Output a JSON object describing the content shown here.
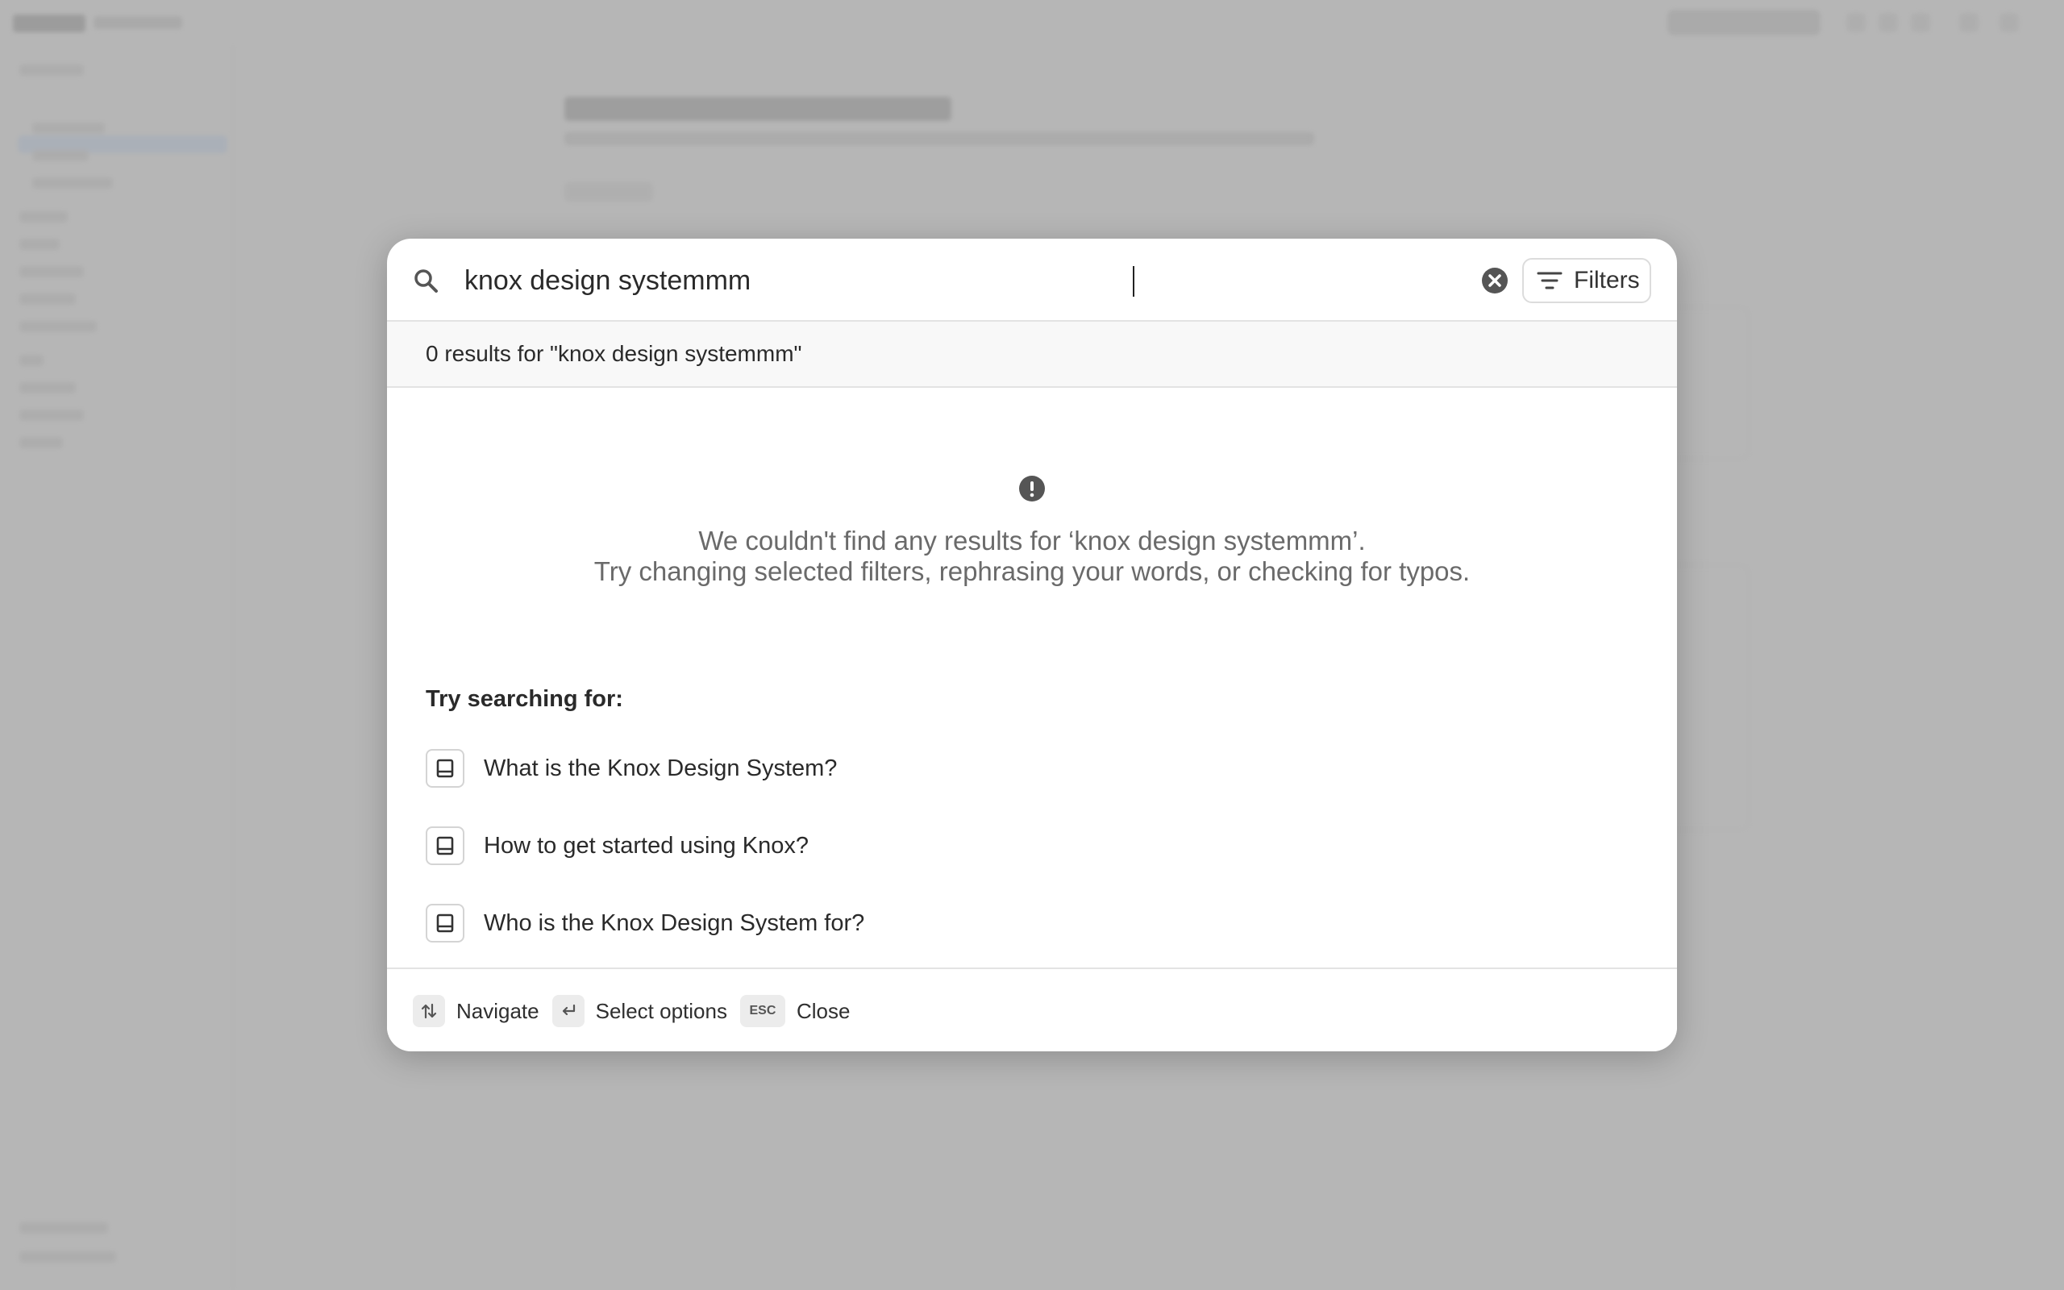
{
  "search": {
    "value": "knox design systemmm",
    "filters_label": "Filters"
  },
  "results": {
    "summary": "0 results for \"knox design systemmm\""
  },
  "empty_state": {
    "line1": "We couldn't find any results for ‘knox design systemmm’.",
    "line2": "Try changing selected filters, rephrasing your words, or checking for typos."
  },
  "suggestions": {
    "heading": "Try searching for:",
    "items": [
      {
        "label": "What is the Knox Design System?",
        "icon": "book-icon"
      },
      {
        "label": "How to get started using Knox?",
        "icon": "book-icon"
      },
      {
        "label": "Who is the Knox Design System for?",
        "icon": "book-icon"
      }
    ]
  },
  "footer": {
    "navigate_label": "Navigate",
    "select_label": "Select options",
    "esc_key": "ESC",
    "close_label": "Close"
  },
  "colors": {
    "backdrop": "#c4c4c4",
    "modal_bg": "#ffffff",
    "results_bar_bg": "#f8f8f8",
    "icon_dark": "#555555"
  }
}
